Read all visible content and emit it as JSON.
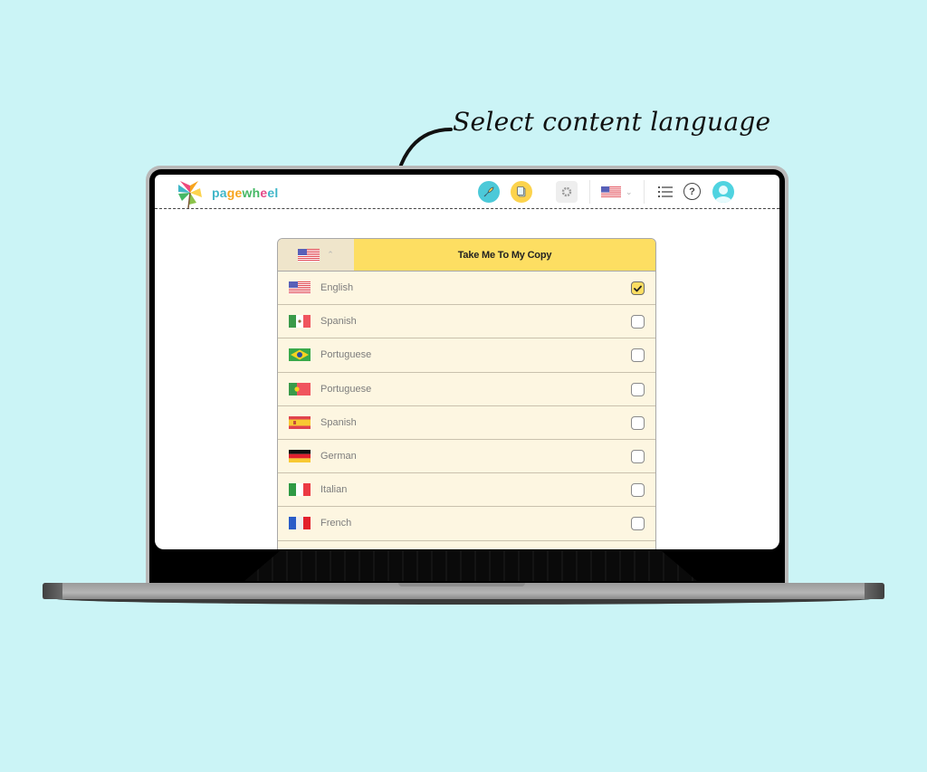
{
  "annotation": {
    "text": "Select content language"
  },
  "app": {
    "brand": {
      "letters": [
        "p",
        "a",
        "g",
        "e",
        "w",
        "h",
        "e",
        "e",
        "l"
      ],
      "letter_colors": [
        "#3fb6c8",
        "#3fb6c8",
        "#f7a41d",
        "#f7a41d",
        "#45b865",
        "#45b865",
        "#e44c8a",
        "#3fb6c8",
        "#3fb6c8"
      ]
    },
    "header": {
      "icons": {
        "rocket": "rocket-icon",
        "copy": "copy-icon",
        "settings": "gear-icon",
        "language": "us-flag-icon",
        "list": "list-icon",
        "help": "help-icon",
        "avatar": "user-avatar-icon"
      },
      "help_glyph": "?"
    },
    "language_panel": {
      "current_language": "English",
      "action_label": "Take Me To My Copy",
      "languages": [
        {
          "name": "English",
          "flag": "us",
          "checked": true
        },
        {
          "name": "Spanish",
          "flag": "mx",
          "checked": false
        },
        {
          "name": "Portuguese",
          "flag": "br",
          "checked": false
        },
        {
          "name": "Portuguese",
          "flag": "pt",
          "checked": false
        },
        {
          "name": "Spanish",
          "flag": "es",
          "checked": false
        },
        {
          "name": "German",
          "flag": "de",
          "checked": false
        },
        {
          "name": "Italian",
          "flag": "it",
          "checked": false
        },
        {
          "name": "French",
          "flag": "fr",
          "checked": false
        }
      ]
    },
    "colors": {
      "accent_yellow": "#fdde62",
      "accent_cyan": "#4cc9d8",
      "panel_bg": "#fdf6e1",
      "page_bg": "#cbf4f6"
    }
  }
}
